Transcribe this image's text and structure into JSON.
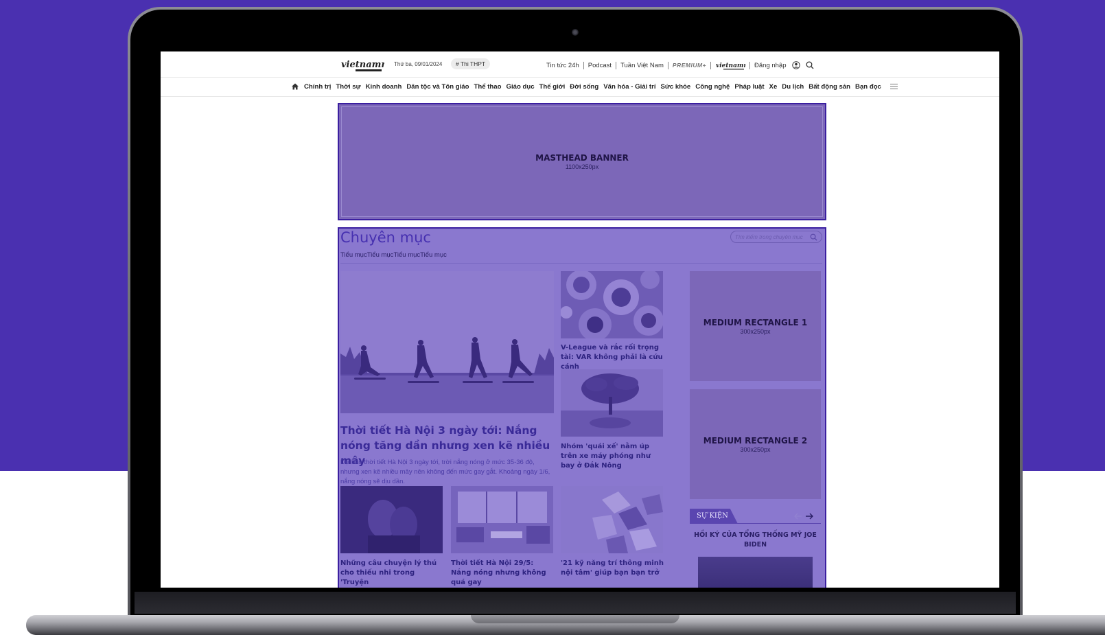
{
  "header": {
    "logo_text": "vietnamnet",
    "date": "Thứ ba, 09/01/2024",
    "tag": "# Thi THPT",
    "links": [
      "Tin tức 24h",
      "Podcast",
      "Tuần Việt Nam"
    ],
    "premium": "PREMIUM+",
    "global_logo_text": "vietnamnet",
    "login": "Đăng nhập"
  },
  "nav": {
    "items": [
      "Chính trị",
      "Thời sự",
      "Kinh doanh",
      "Dân tộc và Tôn giáo",
      "Thể thao",
      "Giáo dục",
      "Thế giới",
      "Đời sống",
      "Văn hóa - Giải trí",
      "Sức khỏe",
      "Công nghệ",
      "Pháp luật",
      "Xe",
      "Du lịch",
      "Bất động sản",
      "Bạn đọc"
    ]
  },
  "masthead": {
    "title": "MASTHEAD BANNER",
    "size": "1100x250px"
  },
  "section": {
    "title": "Chuyên mục",
    "search_placeholder": "Tìm kiếm trong chuyên mục",
    "subnav": [
      "Tiểu mục",
      "Tiểu mục",
      "Tiểu mục",
      "Tiểu mục"
    ]
  },
  "featured": {
    "title": "Thời tiết Hà Nội 3 ngày tới: Nắng nóng tăng dần nhưng xen kẽ nhiều mây",
    "sapo": "Dự báo thời tiết Hà Nội 3 ngày tới, trời nắng nóng ở mức 35-36 độ, nhưng xen kẽ nhiều mây nên không đến mức gay gắt. Khoảng ngày 1/6, nắng nóng sẽ dịu dần."
  },
  "side_articles": [
    {
      "title": "V-League và rắc rối trọng tài: VAR không phải là cứu cánh"
    },
    {
      "title": "Nhóm 'quái xế' nằm úp trên xe máy phóng như bay ở Đắk Nông"
    }
  ],
  "bottom_articles": [
    {
      "title": "Những câu chuyện lý thú cho thiếu nhi trong 'Truyện"
    },
    {
      "title": "Thời tiết Hà Nội 29/5: Nắng nóng nhưng không quá gay"
    },
    {
      "title": "'21 kỹ năng trí thông minh nội tâm' giúp bạn bạn trở"
    }
  ],
  "ads": [
    {
      "title": "MEDIUM RECTANGLE 1",
      "size": "300x250px"
    },
    {
      "title": "MEDIUM RECTANGLE 2",
      "size": "300x250px"
    }
  ],
  "event": {
    "label": "SỰ KIỆN",
    "title": "HỒI KÝ CỦA TỔNG THỐNG MỸ JOE BIDEN"
  },
  "colors": {
    "background": "#4a30b0",
    "overlay": "#8a78cf",
    "overlay_border": "#3b1fa0",
    "section_title": "#4630b0"
  }
}
